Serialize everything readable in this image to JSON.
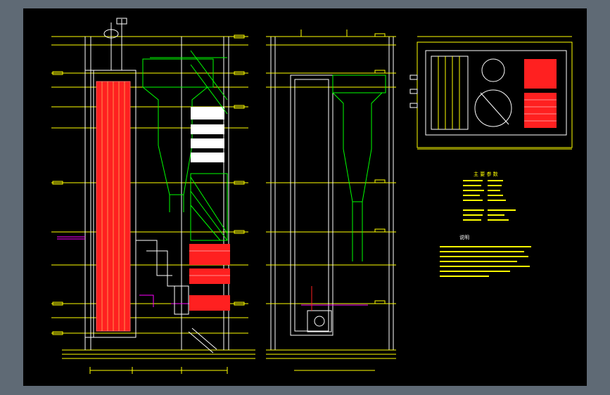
{
  "notes_heading": "说明",
  "tables": {
    "main_params_heading": "主 要 参 数"
  },
  "colors": {
    "background": "#000000",
    "frame": "#5f6a75",
    "annotation": "#ffff00",
    "outline": "#ffffff",
    "steel_structure": "#00ff00",
    "heating_surface": "#ff2020",
    "piping": "#ff00ff"
  }
}
